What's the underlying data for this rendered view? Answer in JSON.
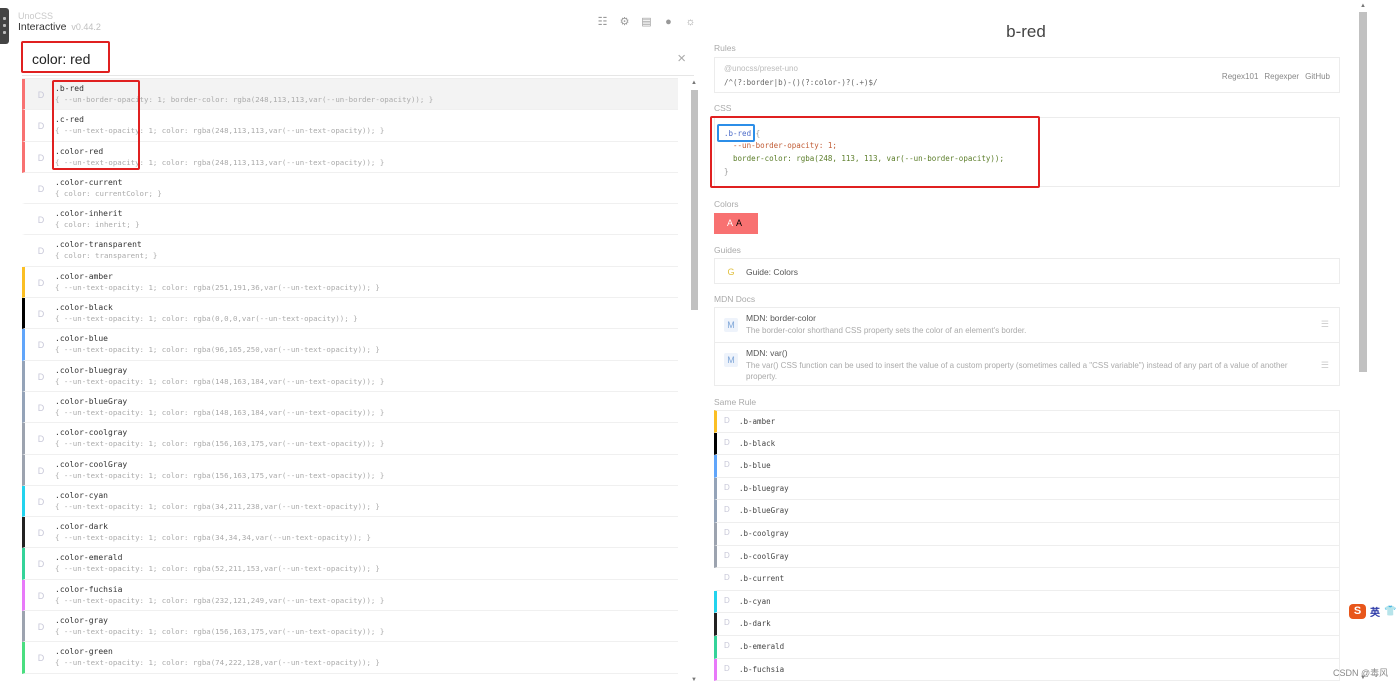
{
  "header": {
    "brand_small": "UnoCSS",
    "title": "Interactive",
    "version": "v0.44.2",
    "toolbar_icons": [
      "list-icon",
      "gear-icon",
      "panel-icon",
      "github-icon",
      "sun-icon"
    ]
  },
  "search": {
    "value": "color: red",
    "clear": "×"
  },
  "results": [
    {
      "name": ".b-red",
      "css": "{ --un-border-opacity: 1; border-color: rgba(248,113,113,var(--un-border-opacity)); }",
      "color": "#f87171",
      "selected": true
    },
    {
      "name": ".c-red",
      "css": "{ --un-text-opacity: 1; color: rgba(248,113,113,var(--un-text-opacity)); }",
      "color": "#f87171"
    },
    {
      "name": ".color-red",
      "css": "{ --un-text-opacity: 1; color: rgba(248,113,113,var(--un-text-opacity)); }",
      "color": "#f87171"
    },
    {
      "name": ".color-current",
      "css": "{ color: currentColor; }",
      "color": ""
    },
    {
      "name": ".color-inherit",
      "css": "{ color: inherit; }",
      "color": ""
    },
    {
      "name": ".color-transparent",
      "css": "{ color: transparent; }",
      "color": ""
    },
    {
      "name": ".color-amber",
      "css": "{ --un-text-opacity: 1; color: rgba(251,191,36,var(--un-text-opacity)); }",
      "color": "#fbbf24"
    },
    {
      "name": ".color-black",
      "css": "{ --un-text-opacity: 1; color: rgba(0,0,0,var(--un-text-opacity)); }",
      "color": "#000000"
    },
    {
      "name": ".color-blue",
      "css": "{ --un-text-opacity: 1; color: rgba(96,165,250,var(--un-text-opacity)); }",
      "color": "#60a5fa"
    },
    {
      "name": ".color-bluegray",
      "css": "{ --un-text-opacity: 1; color: rgba(148,163,184,var(--un-text-opacity)); }",
      "color": "#94a3b8"
    },
    {
      "name": ".color-blueGray",
      "css": "{ --un-text-opacity: 1; color: rgba(148,163,184,var(--un-text-opacity)); }",
      "color": "#94a3b8"
    },
    {
      "name": ".color-coolgray",
      "css": "{ --un-text-opacity: 1; color: rgba(156,163,175,var(--un-text-opacity)); }",
      "color": "#9ca3af"
    },
    {
      "name": ".color-coolGray",
      "css": "{ --un-text-opacity: 1; color: rgba(156,163,175,var(--un-text-opacity)); }",
      "color": "#9ca3af"
    },
    {
      "name": ".color-cyan",
      "css": "{ --un-text-opacity: 1; color: rgba(34,211,238,var(--un-text-opacity)); }",
      "color": "#22d3ee"
    },
    {
      "name": ".color-dark",
      "css": "{ --un-text-opacity: 1; color: rgba(34,34,34,var(--un-text-opacity)); }",
      "color": "#222222"
    },
    {
      "name": ".color-emerald",
      "css": "{ --un-text-opacity: 1; color: rgba(52,211,153,var(--un-text-opacity)); }",
      "color": "#34d399"
    },
    {
      "name": ".color-fuchsia",
      "css": "{ --un-text-opacity: 1; color: rgba(232,121,249,var(--un-text-opacity)); }",
      "color": "#e879f9"
    },
    {
      "name": ".color-gray",
      "css": "{ --un-text-opacity: 1; color: rgba(156,163,175,var(--un-text-opacity)); }",
      "color": "#9ca3af"
    },
    {
      "name": ".color-green",
      "css": "{ --un-text-opacity: 1; color: rgba(74,222,128,var(--un-text-opacity)); }",
      "color": "#4ade80"
    }
  ],
  "detail": {
    "title": "b-red",
    "rules_label": "Rules",
    "rules_source": "@unocss/preset-uno",
    "rules_regex": "/^(?:border|b)-()(?:color-)?(.+)$/",
    "rules_links": [
      "Regex101",
      "Regexper",
      "GitHub"
    ],
    "css_label": "CSS",
    "css": {
      "selector": ".b-red",
      "open": " {",
      "var_line": "  --un-border-opacity: 1;",
      "prop_line": "  border-color: rgba(248, 113, 113, var(--un-border-opacity));",
      "close": "}"
    },
    "colors_label": "Colors",
    "swatch": {
      "a1": "A",
      "a2": "A",
      "color": "#f87171"
    },
    "guides_label": "Guides",
    "guide": {
      "badge": "G",
      "text": "Guide: Colors"
    },
    "mdn_label": "MDN Docs",
    "mdn": [
      {
        "badge": "M",
        "title": "MDN: border-color",
        "desc": "The border-color shorthand CSS property sets the color of an element's border.",
        "menu": "☰"
      },
      {
        "badge": "M",
        "title": "MDN: var()",
        "desc": "The var() CSS function can be used to insert the value of a custom property (sometimes called a \"CSS variable\") instead of any part of a value of another property.",
        "menu": "☰"
      }
    ],
    "same_rule_label": "Same Rule",
    "same_rule": [
      {
        "name": ".b-amber",
        "color": "#fbbf24"
      },
      {
        "name": ".b-black",
        "color": "#000000"
      },
      {
        "name": ".b-blue",
        "color": "#60a5fa"
      },
      {
        "name": ".b-bluegray",
        "color": "#94a3b8"
      },
      {
        "name": ".b-blueGray",
        "color": "#94a3b8"
      },
      {
        "name": ".b-coolgray",
        "color": "#9ca3af"
      },
      {
        "name": ".b-coolGray",
        "color": "#9ca3af"
      },
      {
        "name": ".b-current",
        "color": ""
      },
      {
        "name": ".b-cyan",
        "color": "#22d3ee"
      },
      {
        "name": ".b-dark",
        "color": "#222222"
      },
      {
        "name": ".b-emerald",
        "color": "#34d399"
      },
      {
        "name": ".b-fuchsia",
        "color": "#e879f9"
      }
    ]
  },
  "ime": {
    "logo": "S",
    "lang": "英",
    "extra": "👕"
  },
  "watermark": "CSDN @毒风",
  "colors": {
    "accent": "#f87171",
    "highlight_red": "#e02020",
    "highlight_blue": "#2c8ee8"
  }
}
